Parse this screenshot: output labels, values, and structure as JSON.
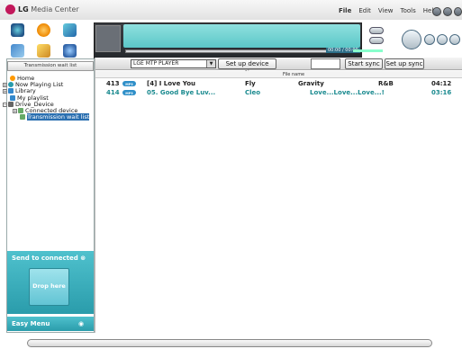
{
  "app": {
    "brand": "LG",
    "title": "Media Center"
  },
  "menu": [
    "File",
    "Edit",
    "View",
    "Tools",
    "Help"
  ],
  "player": {
    "time_readout": "00:00 / 00:00"
  },
  "sidebar": {
    "header": "Transmission wait list",
    "tree": [
      {
        "label": "Home",
        "pm": ""
      },
      {
        "label": "Now Playing List",
        "pm": "+"
      },
      {
        "label": "Library",
        "pm": "+"
      },
      {
        "label": "My playlist",
        "pm": ""
      },
      {
        "label": "Drive_Device",
        "pm": "−"
      },
      {
        "label": "Connected device",
        "pm": "+"
      },
      {
        "label": "Transmission wait list",
        "pm": ""
      }
    ],
    "send_title": "Send to connected",
    "drop_label": "Drop here",
    "easy_menu": "Easy Menu"
  },
  "device": {
    "selected": "LGE MTP PLAYER",
    "setup_option": "Set up device option",
    "start_sync": "Start sync",
    "setup_sync": "Set up sync"
  },
  "list": {
    "column_file_name": "File name",
    "badge": "MP3",
    "rows": [
      {
        "num": "413",
        "title": "[4] I Love You",
        "artist": "Fly",
        "album": "Gravity",
        "genre": "R&B",
        "time": "04:12"
      },
      {
        "num": "414",
        "title": "05. Good Bye Luv...",
        "artist": "Cleo",
        "album": "Love...Love...Love...!",
        "genre": "",
        "time": "03:16"
      }
    ]
  },
  "colors": {
    "accent": "#2a9cab",
    "selected": "#2a6fb0",
    "row_highlight": "#1a8a8f"
  }
}
